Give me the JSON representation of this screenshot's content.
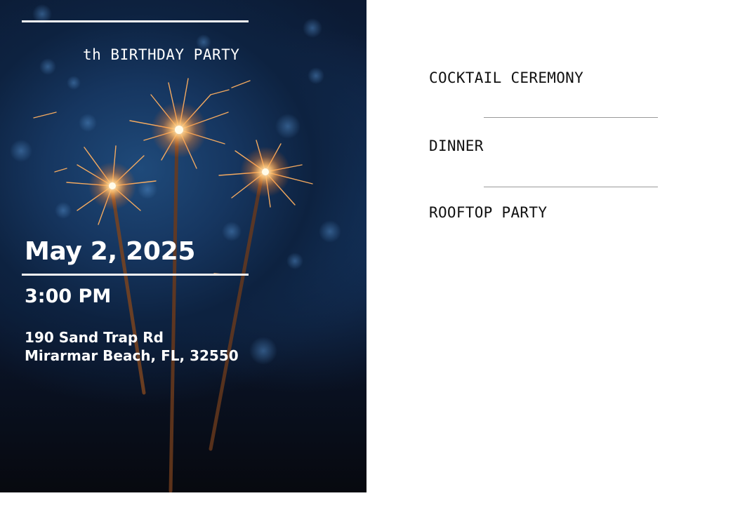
{
  "invitation": {
    "title": "th BIRTHDAY PARTY",
    "date": "May 2, 2025",
    "time": "3:00 PM",
    "address_line1": "190 Sand Trap Rd",
    "address_line2": "Mirarmar Beach, FL, 32550"
  },
  "schedule": {
    "items": [
      "COCKTAIL CEREMONY",
      "DINNER",
      "ROOFTOP PARTY"
    ]
  },
  "colors": {
    "background_dark": "#0d2240",
    "spark": "#ffb060",
    "text_light": "#ffffff",
    "text_dark": "#111111",
    "divider": "#9a9a9a"
  }
}
